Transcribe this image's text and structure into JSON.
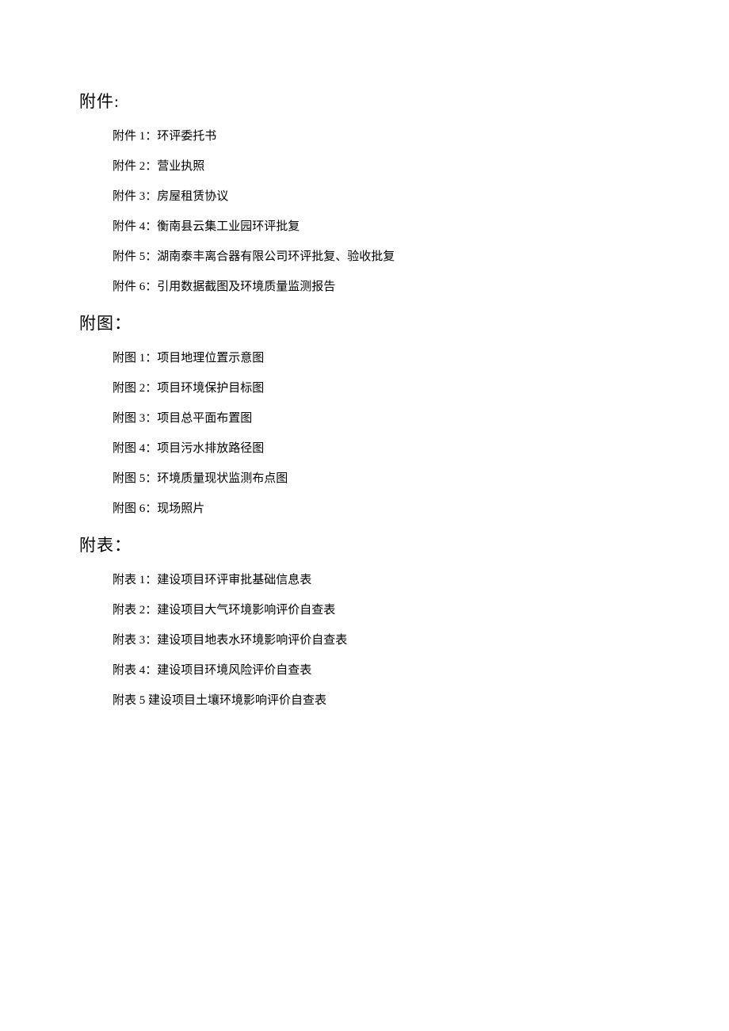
{
  "sections": [
    {
      "title": "附件:",
      "items": [
        "附件 1：环评委托书",
        "附件 2：营业执照",
        "附件 3：房屋租赁协议",
        "附件 4：衡南县云集工业园环评批复",
        "附件 5：湖南泰丰离合器有限公司环评批复、验收批复",
        "附件 6：引用数据截图及环境质量监测报告"
      ]
    },
    {
      "title": "附图：",
      "items": [
        "附图 1：项目地理位置示意图",
        "附图 2：项目环境保护目标图",
        "附图 3：项目总平面布置图",
        "附图 4：项目污水排放路径图",
        "附图 5：环境质量现状监测布点图",
        "附图 6：现场照片"
      ]
    },
    {
      "title": "附表：",
      "items": [
        "附表 1：建设项目环评审批基础信息表",
        "附表 2：建设项目大气环境影响评价自查表",
        "附表 3：建设项目地表水环境影响评价自查表",
        "附表 4：建设项目环境风险评价自查表",
        "附表 5 建设项目土壤环境影响评价自查表"
      ]
    }
  ]
}
